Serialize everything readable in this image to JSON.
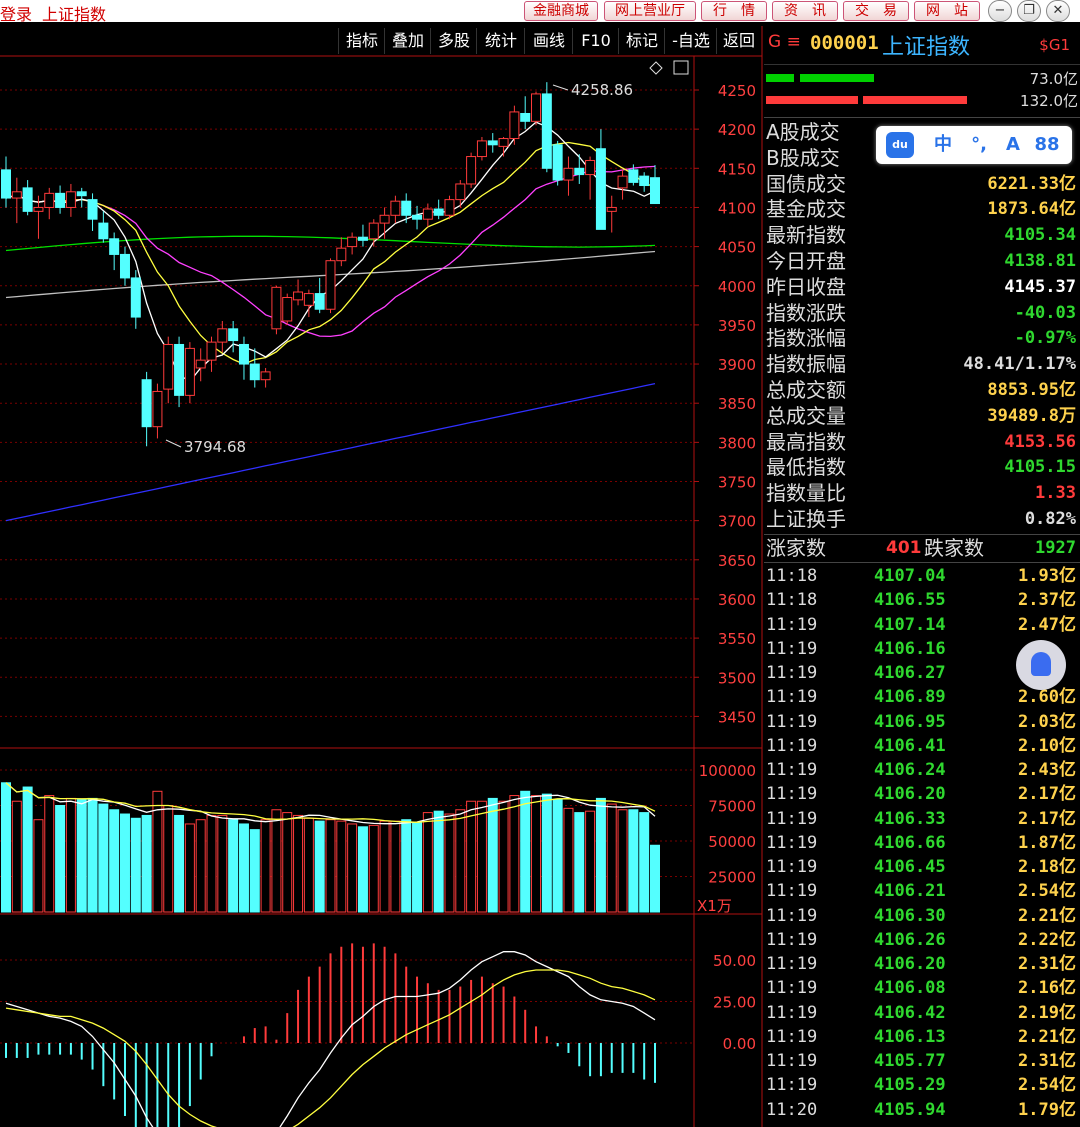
{
  "titlebar": {
    "left_labels": [
      "登录",
      "上证指数"
    ],
    "buttons": [
      "金融商城",
      "网上营业厅",
      "行　情",
      "资　讯",
      "交　易",
      "网　站"
    ],
    "window_buttons": [
      "minimize-icon",
      "restore-icon",
      "close-icon"
    ]
  },
  "toolbar": {
    "items": [
      "指标",
      "叠加",
      "多股",
      "统计",
      "画线",
      "F10",
      "标记",
      "-自选",
      "返回"
    ]
  },
  "price_axis": [
    "4250",
    "4200",
    "4150",
    "4100",
    "4050",
    "4000",
    "3950",
    "3900",
    "3850",
    "3800",
    "3750",
    "3700",
    "3650",
    "3600",
    "3550",
    "3500",
    "3450"
  ],
  "volume_axis": [
    "100000",
    "75000",
    "50000",
    "25000"
  ],
  "volume_unit": "X1万",
  "macd_axis": [
    "50.00",
    "25.00",
    "0.00"
  ],
  "annotations": {
    "high_label": "4258.86",
    "low_label": "3794.68"
  },
  "chart_data": {
    "type": "candlestick",
    "series_colors": {
      "up": "#ff3b3b",
      "down": "#54ffff",
      "ma5": "#ffffff",
      "ma10": "#ffff40",
      "ma20": "#ff40ff",
      "ma60": "#00e000",
      "ma120": "#c0c0c0",
      "ma250": "#3030ff"
    },
    "ylim": [
      3420,
      4290
    ],
    "candles": [
      [
        4148,
        4165,
        4100,
        4112
      ],
      [
        4112,
        4138,
        4080,
        4120
      ],
      [
        4125,
        4135,
        4090,
        4095
      ],
      [
        4095,
        4115,
        4060,
        4100
      ],
      [
        4100,
        4125,
        4085,
        4118
      ],
      [
        4118,
        4128,
        4092,
        4100
      ],
      [
        4100,
        4130,
        4088,
        4120
      ],
      [
        4120,
        4125,
        4100,
        4115
      ],
      [
        4110,
        4118,
        4070,
        4085
      ],
      [
        4080,
        4095,
        4055,
        4060
      ],
      [
        4060,
        4068,
        4020,
        4040
      ],
      [
        4040,
        4050,
        4000,
        4010
      ],
      [
        4010,
        4020,
        3945,
        3960
      ],
      [
        3880,
        3890,
        3795,
        3820
      ],
      [
        3820,
        3875,
        3805,
        3865
      ],
      [
        3868,
        3935,
        3850,
        3925
      ],
      [
        3925,
        3935,
        3845,
        3860
      ],
      [
        3860,
        3928,
        3850,
        3920
      ],
      [
        3895,
        3920,
        3878,
        3905
      ],
      [
        3905,
        3935,
        3890,
        3928
      ],
      [
        3928,
        3955,
        3915,
        3945
      ],
      [
        3945,
        3955,
        3915,
        3930
      ],
      [
        3925,
        3935,
        3880,
        3900
      ],
      [
        3900,
        3920,
        3870,
        3880
      ],
      [
        3880,
        3895,
        3870,
        3890
      ],
      [
        3945,
        4000,
        3938,
        3998
      ],
      [
        3955,
        3990,
        3950,
        3985
      ],
      [
        3982,
        4008,
        3975,
        3992
      ],
      [
        3975,
        3995,
        3960,
        3990
      ],
      [
        3990,
        4010,
        3965,
        3970
      ],
      [
        3970,
        4035,
        3965,
        4032
      ],
      [
        4032,
        4062,
        4025,
        4048
      ],
      [
        4050,
        4068,
        4040,
        4062
      ],
      [
        4062,
        4078,
        4050,
        4058
      ],
      [
        4060,
        4085,
        4050,
        4080
      ],
      [
        4080,
        4100,
        4060,
        4090
      ],
      [
        4090,
        4115,
        4080,
        4108
      ],
      [
        4108,
        4118,
        4080,
        4090
      ],
      [
        4090,
        4102,
        4072,
        4085
      ],
      [
        4085,
        4105,
        4075,
        4098
      ],
      [
        4098,
        4110,
        4085,
        4090
      ],
      [
        4090,
        4115,
        4085,
        4110
      ],
      [
        4110,
        4135,
        4100,
        4130
      ],
      [
        4130,
        4170,
        4125,
        4165
      ],
      [
        4165,
        4190,
        4160,
        4185
      ],
      [
        4185,
        4195,
        4170,
        4180
      ],
      [
        4178,
        4190,
        4165,
        4188
      ],
      [
        4188,
        4230,
        4180,
        4222
      ],
      [
        4220,
        4242,
        4200,
        4210
      ],
      [
        4210,
        4248,
        4205,
        4245
      ],
      [
        4245,
        4260,
        4145,
        4150
      ],
      [
        4180,
        4185,
        4128,
        4135
      ],
      [
        4135,
        4165,
        4115,
        4150
      ],
      [
        4150,
        4168,
        4130,
        4142
      ],
      [
        4142,
        4165,
        4110,
        4160
      ],
      [
        4175,
        4200,
        4095,
        4072
      ],
      [
        4095,
        4115,
        4068,
        4100
      ],
      [
        4125,
        4148,
        4110,
        4140
      ],
      [
        4148,
        4155,
        4128,
        4132
      ],
      [
        4140,
        4145,
        4120,
        4128
      ],
      [
        4138,
        4154,
        4105,
        4105
      ]
    ],
    "volumes": [
      91,
      78,
      88,
      65,
      82,
      75,
      80,
      79,
      80,
      76,
      72,
      69,
      66,
      68,
      85,
      75,
      68,
      62,
      65,
      68,
      68,
      65,
      62,
      58,
      65,
      72,
      70,
      68,
      66,
      64,
      65,
      64,
      62,
      60,
      61,
      64,
      64,
      65,
      63,
      70,
      71,
      69,
      72,
      78,
      78,
      80,
      78,
      82,
      85,
      82,
      83,
      79,
      73,
      70,
      71,
      80,
      76,
      72,
      72,
      70,
      47
    ],
    "macd_dif": [
      24,
      22,
      20,
      18,
      16,
      15,
      13,
      10,
      4,
      -4,
      -12,
      -22,
      -32,
      -45,
      -55,
      -62,
      -64,
      -62,
      -58,
      -54,
      -52,
      -52,
      -55,
      -59,
      -60,
      -54,
      -44,
      -33,
      -24,
      -16,
      -6,
      3,
      11,
      16,
      22,
      26,
      28,
      28,
      28,
      29,
      30,
      33,
      38,
      44,
      49,
      52,
      55,
      55,
      53,
      49,
      46,
      43,
      40,
      34,
      29,
      26,
      25,
      24,
      22,
      18,
      14
    ],
    "macd_dea": [
      21,
      20,
      19,
      18,
      17,
      16,
      16,
      14,
      12,
      9,
      5,
      1,
      -5,
      -13,
      -22,
      -31,
      -38,
      -43,
      -47,
      -50,
      -52,
      -52,
      -53,
      -54,
      -55,
      -55,
      -53,
      -49,
      -44,
      -39,
      -33,
      -26,
      -19,
      -13,
      -8,
      -3,
      1,
      5,
      8,
      11,
      14,
      17,
      21,
      25,
      29,
      34,
      38,
      41,
      43,
      44,
      44,
      44,
      43,
      41,
      39,
      36,
      34,
      33,
      31,
      29,
      26
    ],
    "macd_hist": [
      -9,
      -9,
      -9,
      -7,
      -7,
      -7,
      -7,
      -10,
      -16,
      -26,
      -34,
      -44,
      -54,
      -64,
      -66,
      -62,
      -52,
      -38,
      -22,
      -8,
      0,
      0,
      4,
      9,
      10,
      2,
      18,
      32,
      40,
      46,
      54,
      58,
      60,
      58,
      60,
      58,
      54,
      46,
      40,
      36,
      32,
      32,
      34,
      38,
      40,
      36,
      34,
      28,
      20,
      10,
      4,
      -2,
      -6,
      -14,
      -20,
      -20,
      -18,
      -18,
      -18,
      -22,
      -24
    ]
  },
  "panel": {
    "code_prefix": "G ≡",
    "code": "000001",
    "name": "上证指数",
    "sig": "$G1",
    "buy_amount": "73.0亿",
    "sell_amount": "132.0亿",
    "stats": [
      {
        "label": "A股成交",
        "value": "",
        "color": "#ffd24d"
      },
      {
        "label": "B股成交",
        "value": "",
        "color": "#ffd24d"
      },
      {
        "label": "国债成交",
        "value": "6221.33亿",
        "color": "#ffd24d"
      },
      {
        "label": "基金成交",
        "value": "1873.64亿",
        "color": "#ffd24d"
      },
      {
        "label": "最新指数",
        "value": "4105.34",
        "color": "#2fd82f"
      },
      {
        "label": "今日开盘",
        "value": "4138.81",
        "color": "#2fd82f"
      },
      {
        "label": "昨日收盘",
        "value": "4145.37",
        "color": "#ffffff"
      },
      {
        "label": "指数涨跌",
        "value": "-40.03",
        "color": "#2fd82f"
      },
      {
        "label": "指数涨幅",
        "value": "-0.97%",
        "color": "#2fd82f"
      },
      {
        "label": "指数振幅",
        "value": "48.41/1.17%",
        "color": "#dddddd"
      },
      {
        "label": "总成交额",
        "value": "8853.95亿",
        "color": "#ffd24d"
      },
      {
        "label": "总成交量",
        "value": "39489.8万",
        "color": "#ffd24d"
      },
      {
        "label": "最高指数",
        "value": "4153.56",
        "color": "#ff3b3b"
      },
      {
        "label": "最低指数",
        "value": "4105.15",
        "color": "#2fd82f"
      },
      {
        "label": "指数量比",
        "value": "1.33",
        "color": "#ff3b3b"
      },
      {
        "label": "上证换手",
        "value": "0.82%",
        "color": "#dddddd"
      }
    ],
    "adv_label": "涨家数",
    "adv_value": "401",
    "dec_label": "跌家数",
    "dec_value": "1927",
    "ticks": [
      [
        "11:18",
        "4107.04",
        "1.93亿"
      ],
      [
        "11:18",
        "4106.55",
        "2.37亿"
      ],
      [
        "11:19",
        "4107.14",
        "2.47亿"
      ],
      [
        "11:19",
        "4106.16",
        ""
      ],
      [
        "11:19",
        "4106.27",
        ""
      ],
      [
        "11:19",
        "4106.89",
        "2.60亿"
      ],
      [
        "11:19",
        "4106.95",
        "2.03亿"
      ],
      [
        "11:19",
        "4106.41",
        "2.10亿"
      ],
      [
        "11:19",
        "4106.24",
        "2.43亿"
      ],
      [
        "11:19",
        "4106.20",
        "2.17亿"
      ],
      [
        "11:19",
        "4106.33",
        "2.17亿"
      ],
      [
        "11:19",
        "4106.66",
        "1.87亿"
      ],
      [
        "11:19",
        "4106.45",
        "2.18亿"
      ],
      [
        "11:19",
        "4106.21",
        "2.54亿"
      ],
      [
        "11:19",
        "4106.30",
        "2.21亿"
      ],
      [
        "11:19",
        "4106.26",
        "2.22亿"
      ],
      [
        "11:19",
        "4106.20",
        "2.31亿"
      ],
      [
        "11:19",
        "4106.08",
        "2.16亿"
      ],
      [
        "11:19",
        "4106.42",
        "2.19亿"
      ],
      [
        "11:19",
        "4106.13",
        "2.21亿"
      ],
      [
        "11:19",
        "4105.77",
        "2.31亿"
      ],
      [
        "11:19",
        "4105.29",
        "2.54亿"
      ],
      [
        "11:20",
        "4105.94",
        "1.79亿"
      ]
    ]
  },
  "overlay": {
    "logo": "du",
    "items": [
      "中",
      "°,",
      "A",
      "88"
    ]
  }
}
